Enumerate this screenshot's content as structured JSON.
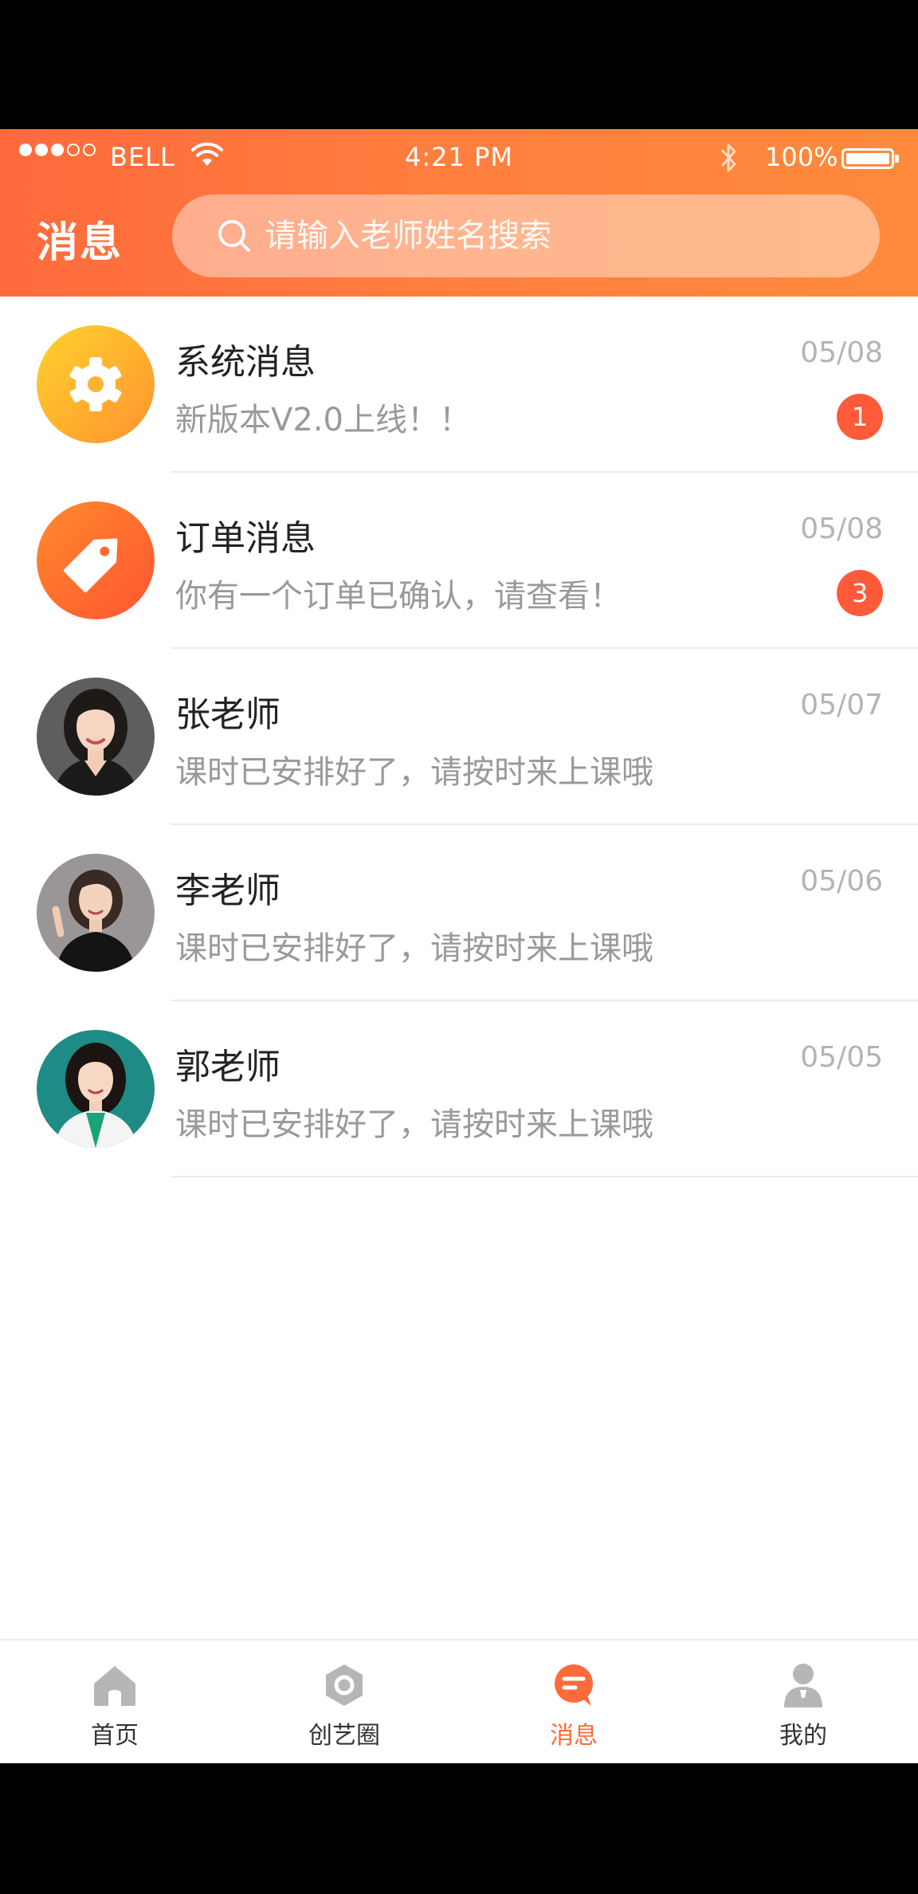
{
  "status_bar": {
    "carrier": "BELL",
    "time": "4:21 PM",
    "battery": "100%"
  },
  "header": {
    "title": "消息",
    "search_placeholder": "请输入老师姓名搜索"
  },
  "messages": [
    {
      "title": "系统消息",
      "preview": "新版本V2.0上线！！",
      "date": "05/08",
      "badge": "1",
      "avatar": "gear-icon"
    },
    {
      "title": "订单消息",
      "preview": "你有一个订单已确认，请查看！",
      "date": "05/08",
      "badge": "3",
      "avatar": "tag-icon"
    },
    {
      "title": "张老师",
      "preview": "课时已安排好了，请按时来上课哦",
      "date": "05/07",
      "badge": null,
      "avatar": "teacher-photo"
    },
    {
      "title": "李老师",
      "preview": "课时已安排好了，请按时来上课哦",
      "date": "05/06",
      "badge": null,
      "avatar": "teacher-photo"
    },
    {
      "title": "郭老师",
      "preview": "课时已安排好了，请按时来上课哦",
      "date": "05/05",
      "badge": null,
      "avatar": "teacher-photo"
    }
  ],
  "tabbar": {
    "items": [
      {
        "label": "首页",
        "icon": "home-icon",
        "active": false
      },
      {
        "label": "创艺圈",
        "icon": "hexagon-icon",
        "active": false
      },
      {
        "label": "消息",
        "icon": "message-icon",
        "active": true
      },
      {
        "label": "我的",
        "icon": "user-icon",
        "active": false
      }
    ]
  },
  "colors": {
    "accent": "#ff6a3d",
    "badge": "#ff5a3a",
    "gear_gradient_start": "#ffca2c",
    "gear_gradient_end": "#ff9b30",
    "tag_gradient_start": "#ff7a2e",
    "tag_gradient_end": "#ff5a2f"
  }
}
